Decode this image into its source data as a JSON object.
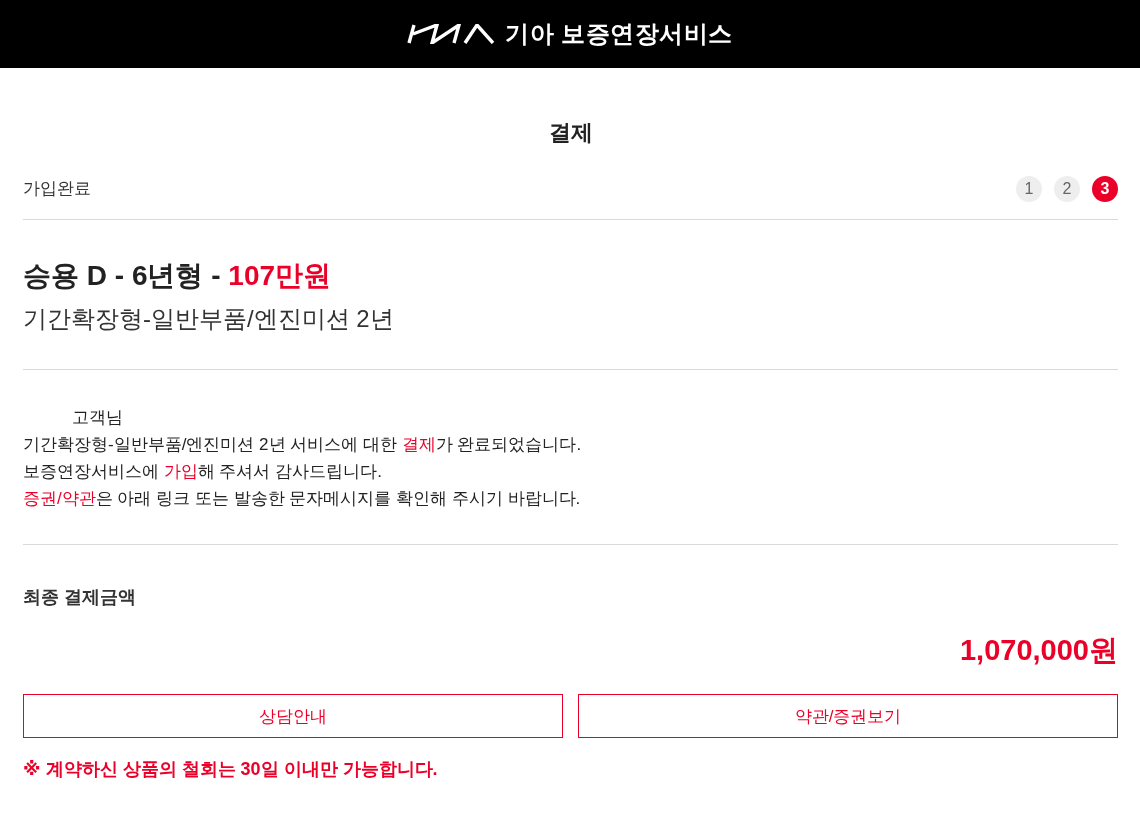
{
  "header": {
    "title": "기아 보증연장서비스"
  },
  "page": {
    "title": "결제"
  },
  "step_bar": {
    "label": "가입완료",
    "steps": [
      {
        "label": "1",
        "selected": false
      },
      {
        "label": "2",
        "selected": false
      },
      {
        "label": "3",
        "selected": true
      }
    ]
  },
  "product": {
    "title": [
      {
        "text": "승용 D - 6년형 - ",
        "highlight": false
      },
      {
        "text": "107만원",
        "highlight": true
      }
    ],
    "subtitle": "기간확장형-일반부품/엔진미션 2년"
  },
  "message": {
    "greeting": "고객님",
    "lines": [
      [
        {
          "text": "기간확장형-일반부품/엔진미션 2년 서비스에 대한 ",
          "highlight": false
        },
        {
          "text": "결제",
          "highlight": true
        },
        {
          "text": "가 완료되었습니다.",
          "highlight": false
        }
      ],
      [
        {
          "text": "보증연장서비스에 ",
          "highlight": false
        },
        {
          "text": "가입",
          "highlight": true
        },
        {
          "text": "해 주셔서 감사드립니다.",
          "highlight": false
        }
      ],
      [
        {
          "text": "증권/약관",
          "highlight": true
        },
        {
          "text": "은 아래 링크 또는 발송한 문자메시지를 확인해 주시기 바랍니다.",
          "highlight": false
        }
      ]
    ]
  },
  "summary": {
    "label": "최종 결제금액",
    "amount": "1,070,000원"
  },
  "buttons": [
    {
      "label": "상담안내"
    },
    {
      "label": "약관/증권보기"
    }
  ],
  "notice": "※ 계약하신 상품의 철회는 30일 이내만 가능합니다."
}
